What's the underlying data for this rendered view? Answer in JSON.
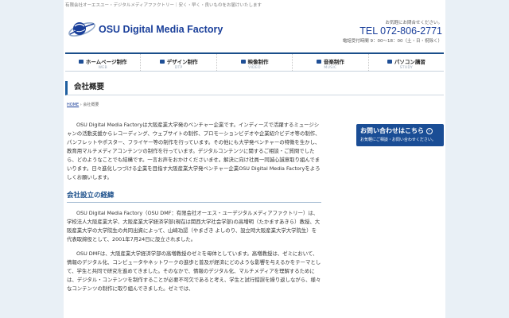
{
  "header": {
    "tagline": "有限会社オーエスユー・デジタルメディアファクトリー｜安く・早く・良いものをお届けいたします",
    "logo_text": "OSU Digital Media Factory",
    "contact_small": "お気軽にお問合せください。",
    "tel": "TEL 072-806-2771",
    "hours": "電話受付時間 9：00～18：00（土・日・祝除く）"
  },
  "nav": {
    "items": [
      {
        "label": "ホームページ制作",
        "sub": "WEB"
      },
      {
        "label": "デザイン制作",
        "sub": "DTP"
      },
      {
        "label": "映像制作",
        "sub": "VIDEO"
      },
      {
        "label": "音楽制作",
        "sub": "MUSIC"
      },
      {
        "label": "パソコン講習",
        "sub": "STUDY"
      }
    ]
  },
  "page": {
    "title": "会社概要",
    "breadcrumb_home": "HOME",
    "breadcrumb_sep": " › ",
    "breadcrumb_current": "会社概要"
  },
  "content": {
    "intro": "OSU Digital Media Factoryは大阪産業大学発のベンチャー企業です。インディーズで活躍するミュージシャンの活動支援からレコーディング、ウェブサイトの制作、プロモーションビデオや企業紹介ビデオ等の制作、パンフレットやポスター、フライヤー等の制作を行っています。その他にも大学発ベンチャーの特徴を生かし、教育用マルチメディアコンテンツの制作を行っています。デジタルコンテンツに関するご相談・ご質問でしたら、どのようなことでも結構です。一言お声をおかけくださいませ。解決に向け社員一同誠心誠意取り組んでまいります。日々進化しつづける企業を目指す大阪産業大学発ベンチャー企業OSU Digital Media Factoryをよろしくお願いします。",
    "section1_heading": "会社設立の経緯",
    "section1_p1": "OSU Digital Media Factory（OSU DMF：有限会社オーエス・ユーデジタルメディアファクトリー）は、学校法人大阪産業大学、大阪産業大学経済学部(現在は関西大学社会学部)の高増明（たかますあきら）教授、大阪産業大学の大学院生の共同出資によって、山崎功認（やまざき よしのり、設立時大阪産業大学大学院生）を代表取締役として、2001年7月24日に設立されました。",
    "section1_p2": "OSU DMFは、大阪産業大学経済学部の高増教授のゼミを母体としています。高増教授は、ゼミにおいて、情報のデジタル化、コンピュータやネットワークの進歩と普及が経済にどのような影響を与えるかをテーマとして、学生と共同で研究を進めてきました。そのなかで、情報のデジタル化、マルチメディアを理解するためには、デジタル・コンテンツを制作することが必要不可欠であると考え、学生と試行錯誤を繰り返しながら、様々なコンテンツの制作に取り組んできました。ゼミでは、"
  },
  "sidebar": {
    "contact_title": "お問い合わせはこちら",
    "contact_arrow": "›",
    "contact_sub": "お気軽にご相談・お問い合わせください。"
  },
  "colors": {
    "accent": "#1a4e8a",
    "brand": "#1a3f9a",
    "background": "#e9f0f6"
  }
}
